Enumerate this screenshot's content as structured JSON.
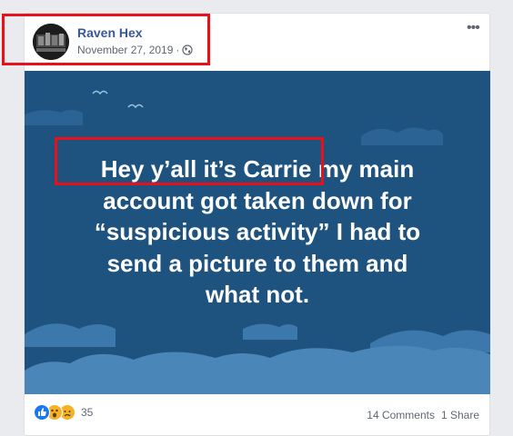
{
  "post": {
    "author": "Raven Hex",
    "date": "November 27, 2019",
    "separator": "·",
    "privacy_icon": "globe-icon",
    "more_icon": "ellipsis-icon",
    "more_label": "•••"
  },
  "banner": {
    "lines": [
      "Hey y’all it’s Carrie my main",
      "account got taken down for",
      "“suspicious activity” I had to",
      "send a picture to them and",
      "what not."
    ],
    "background_color": "#1e5380",
    "text_color": "#ffffff"
  },
  "footer": {
    "reaction_icons": [
      "like-icon",
      "wow-icon",
      "sad-icon"
    ],
    "reaction_count": "35",
    "comments": "14 Comments",
    "shares": "1 Share"
  },
  "colors": {
    "highlight": "#e8101a",
    "link": "#385898",
    "meta": "#616770"
  }
}
